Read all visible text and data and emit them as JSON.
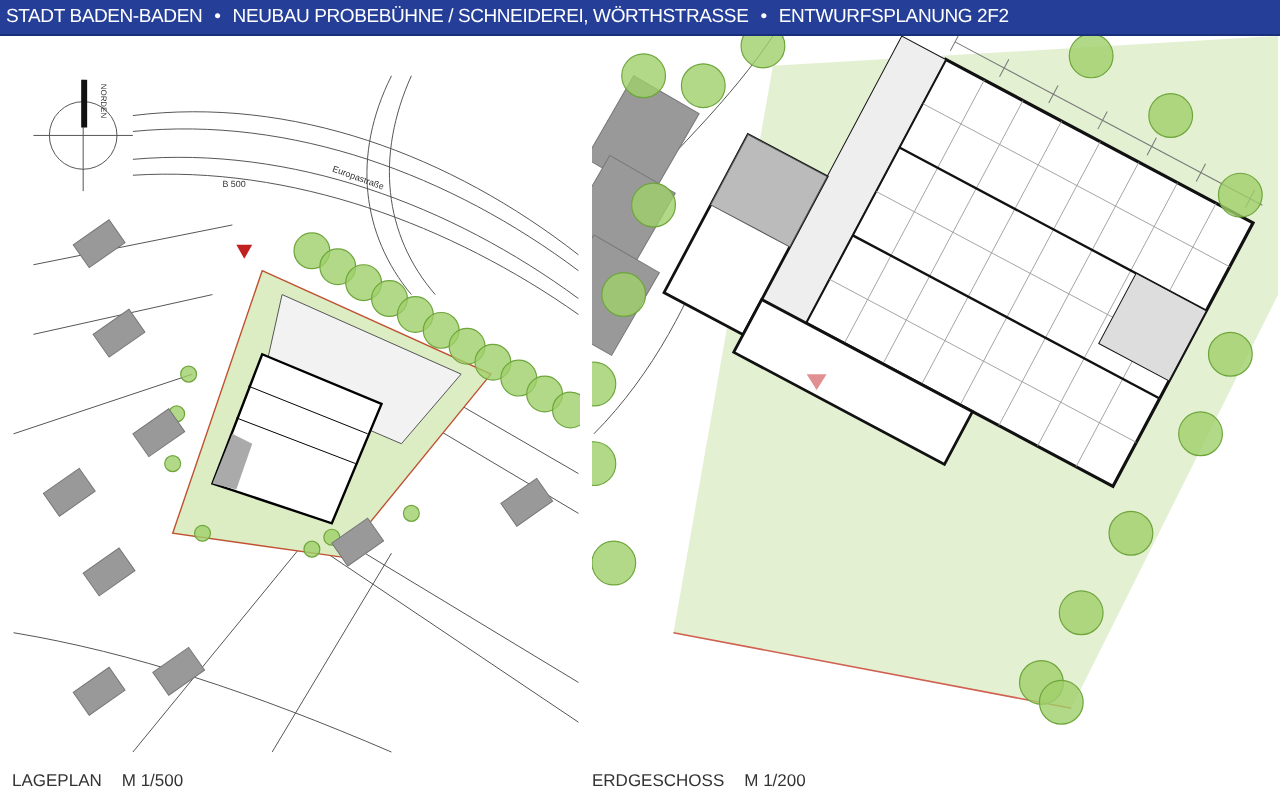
{
  "header": {
    "separator": "•",
    "items": [
      "STADT BADEN-BADEN",
      "NEUBAU PROBEBÜHNE / SCHNEIDEREI, WÖRTHSTRASSE",
      "ENTWURFSPLANUNG 2F2"
    ]
  },
  "panels": [
    {
      "kind": "site_plan",
      "title": "LAGEPLAN",
      "scale": "M 1/500",
      "labels": [
        {
          "kind": "north",
          "text": "NORDEN"
        },
        {
          "kind": "street",
          "text": "Europastraße"
        },
        {
          "kind": "road",
          "text": "B 500"
        }
      ]
    },
    {
      "kind": "floor_plan",
      "title": "ERDGESCHOSS",
      "scale": "M 1/200"
    }
  ]
}
